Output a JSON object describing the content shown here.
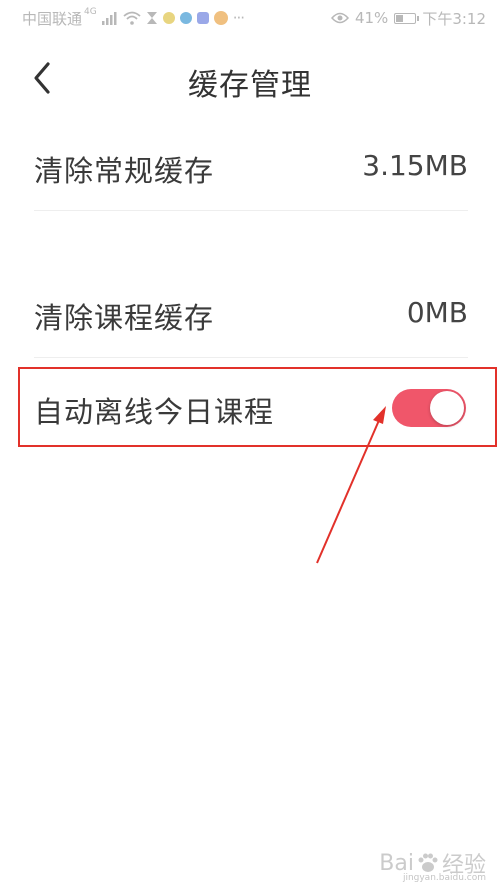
{
  "status_bar": {
    "carrier": "中国联通",
    "network": "4G",
    "battery_percent": "41%",
    "battery_level": 0.41,
    "time": "下午3:12",
    "icons": [
      "signal-icon",
      "wifi-icon",
      "hourglass-icon",
      "app-notification-icon",
      "app-notification-icon",
      "app-notification-icon",
      "app-notification-icon",
      "more-icon",
      "eye-icon",
      "battery-icon"
    ]
  },
  "header": {
    "title": "缓存管理",
    "back_icon": "chevron-left-icon"
  },
  "rows": [
    {
      "label": "清除常规缓存",
      "value": "3.15MB"
    },
    {
      "label": "清除课程缓存",
      "value": "0MB"
    },
    {
      "label": "自动离线今日课程",
      "toggle_on": true
    }
  ],
  "colors": {
    "toggle_on": "#f0566a",
    "highlight": "#e2312a",
    "arrow": "#e2312a"
  },
  "watermark": {
    "text_left": "Bai",
    "text_right": "经验",
    "sub": "jingyan.baidu.com"
  }
}
